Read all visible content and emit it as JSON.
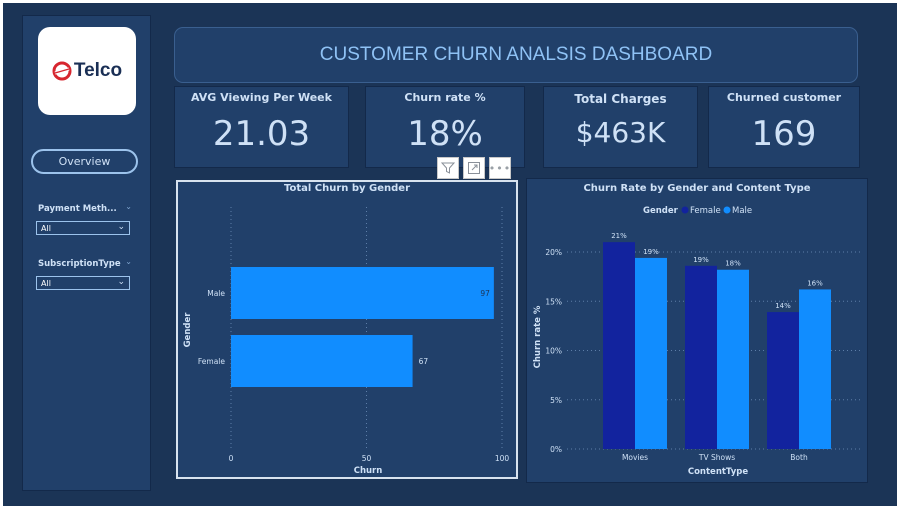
{
  "header": {
    "title": "CUSTOMER CHURN ANALSIS DASHBOARD"
  },
  "logo": {
    "text": "Telco",
    "mark_color": "#d7262f",
    "text_color": "#1a2f55"
  },
  "sidebar": {
    "overview_label": "Overview",
    "slicers": [
      {
        "label": "Payment Meth...",
        "value": "All"
      },
      {
        "label": "SubscriptionType",
        "value": "All"
      }
    ]
  },
  "cards": [
    {
      "title": "AVG Viewing Per Week",
      "value": "21.03"
    },
    {
      "title": "Churn rate %",
      "value": "18%"
    },
    {
      "title": "Total Charges",
      "value": "$463K"
    },
    {
      "title": "Churned customer",
      "value": "169"
    }
  ],
  "colors": {
    "male": "#118dff",
    "female": "#12239e",
    "background": "#1b3456",
    "panel": "#21406a",
    "text": "#cfe1f6"
  },
  "visual_toolbar": [
    "filter-icon",
    "focus-mode-icon",
    "more-options-icon"
  ],
  "chart_data": [
    {
      "type": "bar",
      "orientation": "horizontal",
      "title": "Total Churn by Gender",
      "xlabel": "Churn",
      "ylabel": "Gender",
      "categories": [
        "Male",
        "Female"
      ],
      "values": [
        97,
        67
      ],
      "data_labels": [
        "97",
        "67"
      ],
      "xlim": [
        0,
        100
      ],
      "x_ticks": [
        "0",
        "50",
        "100"
      ],
      "grid": true
    },
    {
      "type": "bar",
      "title": "Churn Rate by Gender and Content Type",
      "xlabel": "ContentType",
      "ylabel": "Churn rate %",
      "legend_title": "Gender",
      "legend_position": "top-center",
      "categories": [
        "Movies",
        "TV Shows",
        "Both"
      ],
      "series": [
        {
          "name": "Female",
          "values": [
            21,
            18.6,
            13.9
          ],
          "labels": [
            "21%",
            "19%",
            "14%"
          ]
        },
        {
          "name": "Male",
          "values": [
            19.4,
            18.2,
            16.2
          ],
          "labels": [
            "19%",
            "18%",
            "16%"
          ]
        }
      ],
      "ylim": [
        0,
        20
      ],
      "y_ticks": [
        "0%",
        "5%",
        "10%",
        "15%",
        "20%"
      ],
      "grid": true
    }
  ]
}
